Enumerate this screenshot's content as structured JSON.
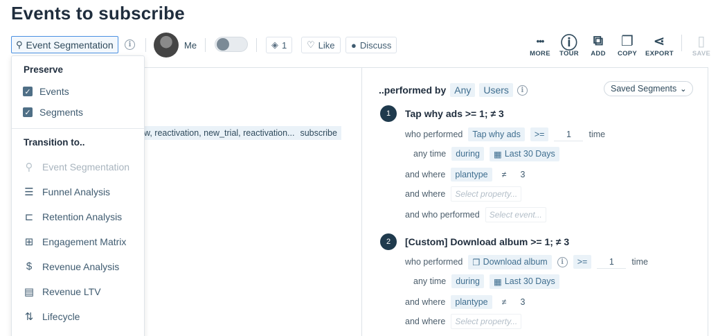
{
  "page": {
    "title": "Events to subscribe"
  },
  "toolbar": {
    "chart_type": "Event Segmentation",
    "owner": "Me",
    "spaces_count": "1",
    "like_label": "Like",
    "discuss_label": "Discuss",
    "actions": [
      {
        "label": "MORE",
        "icon": "more-dots-icon",
        "glyph": "•••"
      },
      {
        "label": "TOUR",
        "icon": "info-circle-icon",
        "glyph": "ⓘ"
      },
      {
        "label": "ADD",
        "icon": "stack-add-icon",
        "glyph": "⧉"
      },
      {
        "label": "COPY",
        "icon": "copy-doc-icon",
        "glyph": "❐"
      },
      {
        "label": "EXPORT",
        "icon": "share-icon",
        "glyph": "⋖"
      },
      {
        "label": "SAVE",
        "icon": "save-icon",
        "glyph": "▯",
        "disabled": true
      }
    ]
  },
  "events_panel": {
    "event_list": "w, reactivation, new_trial, reactivation...",
    "subscribe": "subscribe"
  },
  "segments_panel": {
    "performed_by": "..performed by",
    "any": "Any",
    "users": "Users",
    "saved_segments": "Saved Segments",
    "segments": [
      {
        "number": "1",
        "title": "Tap why ads >= 1; ≠ 3",
        "who_performed": "who performed",
        "event": "Tap why ads",
        "operator": ">=",
        "count": "1",
        "time_word": "time",
        "any_time": "any time",
        "during": "during",
        "date_range": "Last 30 Days",
        "and_where": "and where",
        "property": "plantype",
        "prop_operator": "≠",
        "prop_value": "3",
        "and_where_2": "and where",
        "select_property": "Select property...",
        "and_who_performed": "and who performed",
        "select_event": "Select event..."
      },
      {
        "number": "2",
        "title": "[Custom] Download album >= 1; ≠ 3",
        "who_performed": "who performed",
        "event": "Download album",
        "operator": ">=",
        "count": "1",
        "time_word": "time",
        "any_time": "any time",
        "during": "during",
        "date_range": "Last 30 Days",
        "and_where": "and where",
        "property": "plantype",
        "prop_operator": "≠",
        "prop_value": "3",
        "and_where_2": "and where",
        "select_property": "Select property..."
      }
    ]
  },
  "menu": {
    "preserve_heading": "Preserve",
    "preserve_items": [
      {
        "label": "Events",
        "checked": true
      },
      {
        "label": "Segments",
        "checked": true
      }
    ],
    "transition_heading": "Transition to..",
    "transition_items": [
      {
        "label": "Event Segmentation",
        "icon": "event-segmentation-icon",
        "glyph": "⚲",
        "disabled": true
      },
      {
        "label": "Funnel Analysis",
        "icon": "funnel-icon",
        "glyph": "☰"
      },
      {
        "label": "Retention Analysis",
        "icon": "retention-icon",
        "glyph": "⊏"
      },
      {
        "label": "Engagement Matrix",
        "icon": "engagement-matrix-icon",
        "glyph": "⊞"
      },
      {
        "label": "Revenue Analysis",
        "icon": "revenue-analysis-icon",
        "glyph": "$"
      },
      {
        "label": "Revenue LTV",
        "icon": "revenue-ltv-icon",
        "glyph": "▤"
      },
      {
        "label": "Lifecycle",
        "icon": "lifecycle-icon",
        "glyph": "⇅"
      }
    ]
  },
  "colors": {
    "accent": "#4a90e2",
    "dark": "#1f3a4d",
    "pill_bg": "#eaf2f8"
  }
}
